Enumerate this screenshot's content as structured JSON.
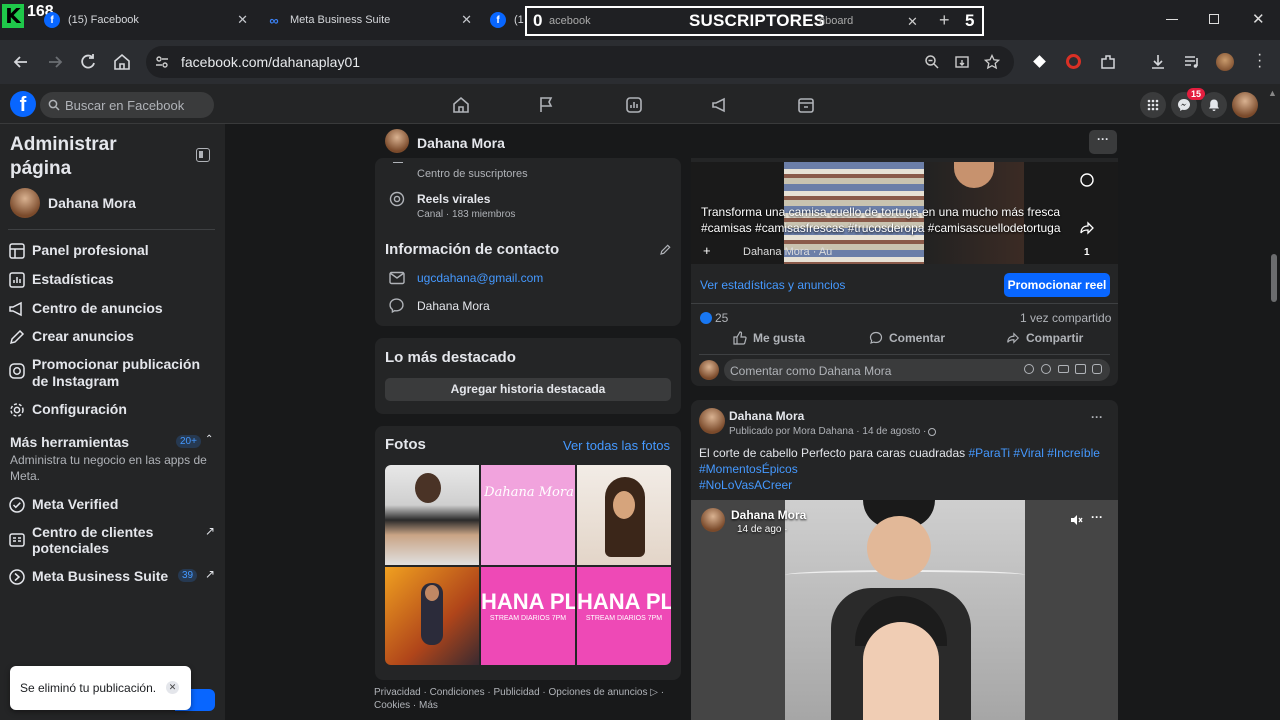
{
  "overlay": {
    "channel_count": "168",
    "subscribers_count": "0",
    "subscribers_label": "SUSCRIPTORES",
    "subscribers_goal": "5"
  },
  "browser": {
    "tabs": [
      {
        "title": "(15) Facebook"
      },
      {
        "title": "Meta Business Suite"
      },
      {
        "title": "(1) Facebook"
      },
      {
        "title": "Dashboard"
      }
    ],
    "url": "facebook.com/dahanaplay01"
  },
  "fb": {
    "search_placeholder": "Buscar en Facebook",
    "notification_badge": "15"
  },
  "sidebar": {
    "title": "Administrar página",
    "page_name": "Dahana Mora",
    "items": [
      {
        "label": "Panel profesional"
      },
      {
        "label": "Estadísticas"
      },
      {
        "label": "Centro de anuncios"
      },
      {
        "label": "Crear anuncios"
      },
      {
        "label": "Promocionar publicación de Instagram"
      },
      {
        "label": "Configuración"
      }
    ],
    "more_tools_title": "Más herramientas",
    "more_tools_badge": "20+",
    "more_tools_desc": "Administra tu negocio en las apps de Meta.",
    "tools": [
      {
        "label": "Meta Verified",
        "badge": ""
      },
      {
        "label": "Centro de clientes potenciales",
        "badge": ""
      },
      {
        "label": "Meta Business Suite",
        "badge": "39"
      }
    ],
    "toast": "Se eliminó tu publicación."
  },
  "page_header": {
    "name": "Dahana Mora"
  },
  "left_col": {
    "subscribers_center": "Centro de suscriptores",
    "channel_name": "Reels virales",
    "channel_members": "Canal · 183 miembros",
    "contact_title": "Información de contacto",
    "email": "ugcdahana@gmail.com",
    "messenger": "Dahana Mora",
    "highlights_title": "Lo más destacado",
    "highlights_button": "Agregar historia destacada",
    "photos_title": "Fotos",
    "photos_link": "Ver todas las fotos",
    "photo_text_1": "Dahana Mora",
    "photo_text_2": "HANA PL",
    "photo_text_3": "HANA PL",
    "photo_sub": "STREAM DIARIOS 7PM",
    "footer": "Privacidad · Condiciones · Publicidad · Opciones de anuncios ▷ · Cookies · Más"
  },
  "post1": {
    "caption": "Transforma una camisa cuello de tortuga en una mucho más fresca #camisas #camisasfrescas #trucosderopa #camisascuellodetortuga",
    "author_tag": "Dahana Mora · Au",
    "counter": "1",
    "stats_link": "Ver estadísticas y anuncios",
    "promote_button": "Promocionar reel",
    "likes": "25",
    "shares": "1 vez compartido",
    "like_label": "Me gusta",
    "comment_label": "Comentar",
    "share_label": "Compartir",
    "comment_placeholder": "Comentar como Dahana Mora"
  },
  "post2": {
    "author": "Dahana Mora",
    "meta": "Publicado por Mora Dahana · 14 de agosto · ",
    "text": "El corte de cabello Perfecto para caras cuadradas",
    "hashtags_inline": "#ParaTi #Viral #Increíble",
    "hashtags_line2": "#MomentosÉpicos",
    "hashtags_line3": "#NoLoVasACreer",
    "video_author": "Dahana Mora",
    "video_date": "14 de ago · "
  },
  "colors": {
    "fb_blue": "#0866ff",
    "link_blue": "#4599ff",
    "bg": "#18191a",
    "card": "#242526"
  }
}
